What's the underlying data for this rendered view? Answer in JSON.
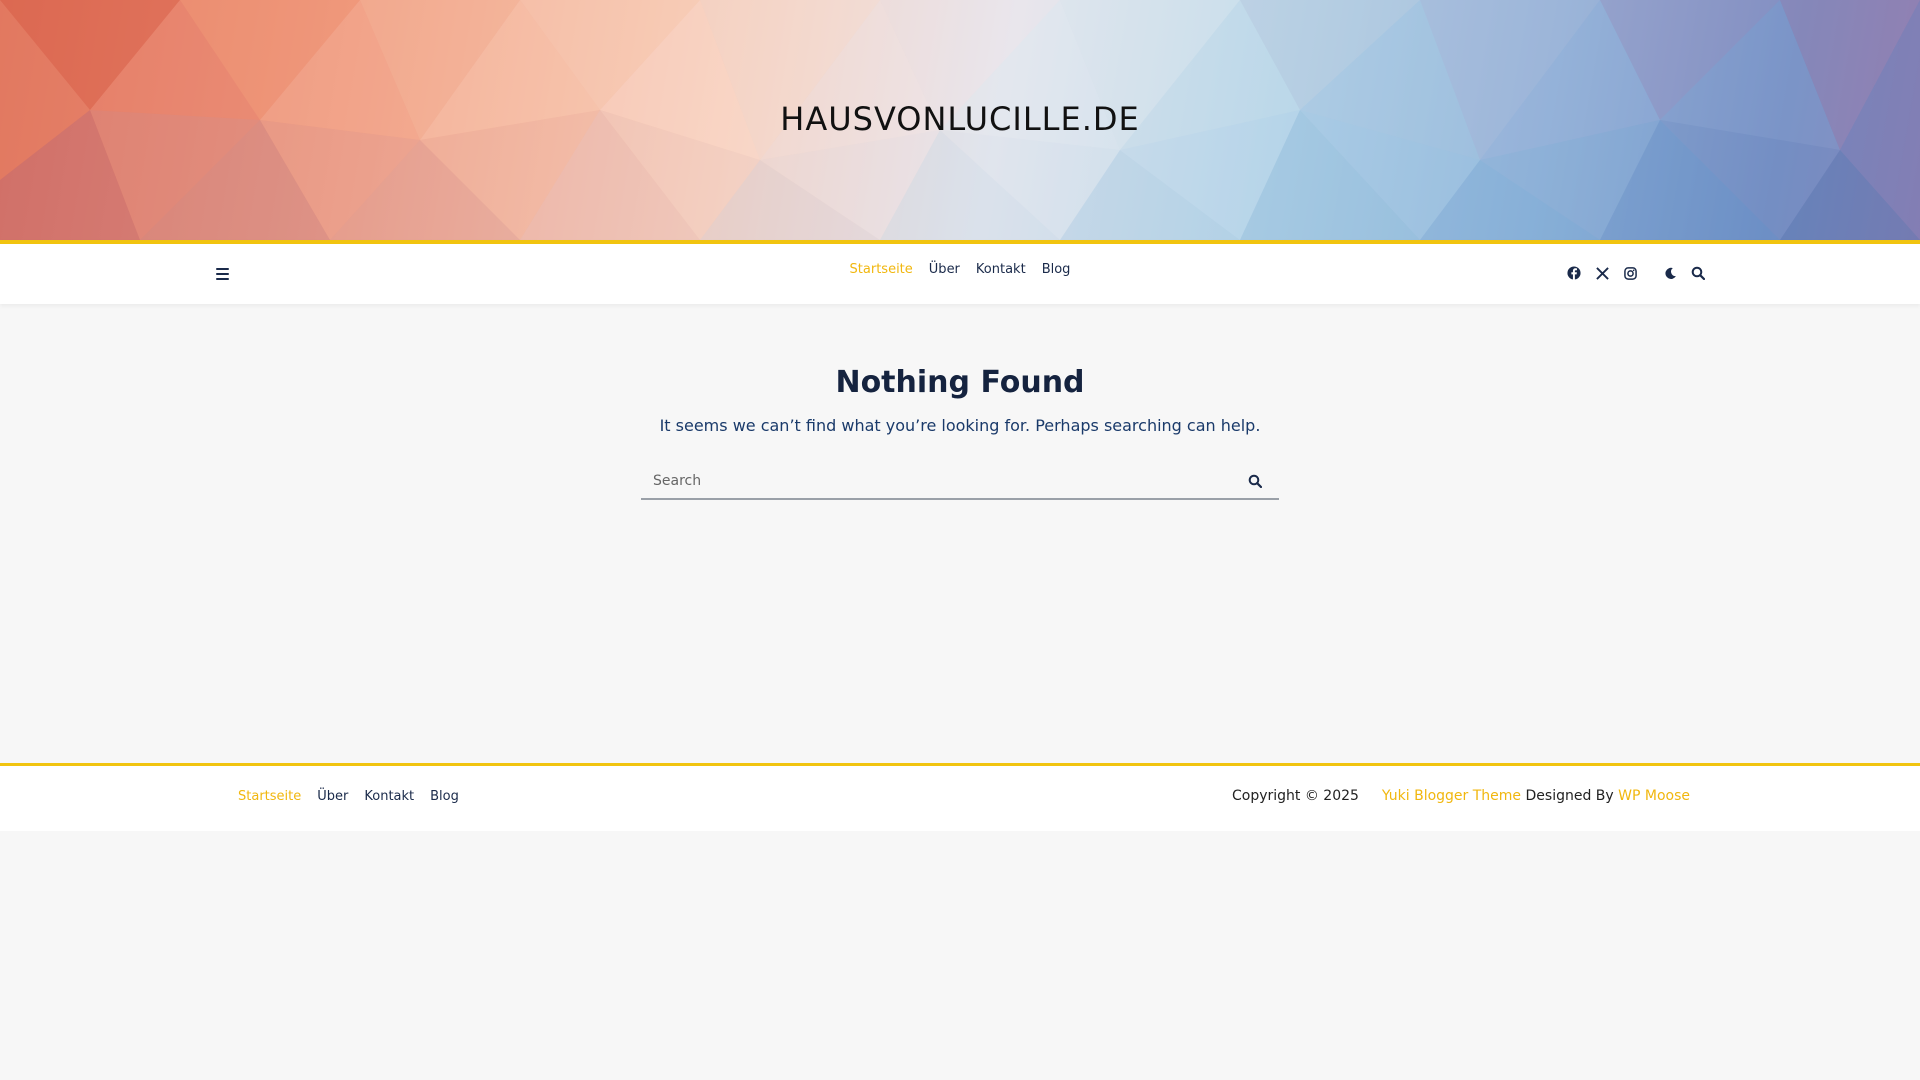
{
  "header": {
    "site_title": "HAUSVONLUCILLE.DE"
  },
  "nav": {
    "items": [
      {
        "label": "Startseite",
        "active": true
      },
      {
        "label": "Über",
        "active": false
      },
      {
        "label": "Kontakt",
        "active": false
      },
      {
        "label": "Blog",
        "active": false
      }
    ],
    "icons": [
      "menu-icon",
      "facebook-icon",
      "x-twitter-icon",
      "instagram-icon",
      "moon-icon",
      "search-icon"
    ]
  },
  "main": {
    "title": "Nothing Found",
    "message": "It seems we can’t find what you’re looking for. Perhaps searching can help.",
    "search": {
      "placeholder": "Search",
      "value": ""
    }
  },
  "footer": {
    "items": [
      {
        "label": "Startseite",
        "active": true
      },
      {
        "label": "Über",
        "active": false
      },
      {
        "label": "Kontakt",
        "active": false
      },
      {
        "label": "Blog",
        "active": false
      }
    ],
    "copyright": "Copyright © 2025",
    "theme_link": "Yuki Blogger Theme",
    "designed_by": "Designed By",
    "author_link": "WP Moose"
  },
  "colors": {
    "accent": "#f1c40f",
    "link_active": "#f1b70f",
    "text_dark": "#15233f",
    "background": "#f7f7f7"
  }
}
